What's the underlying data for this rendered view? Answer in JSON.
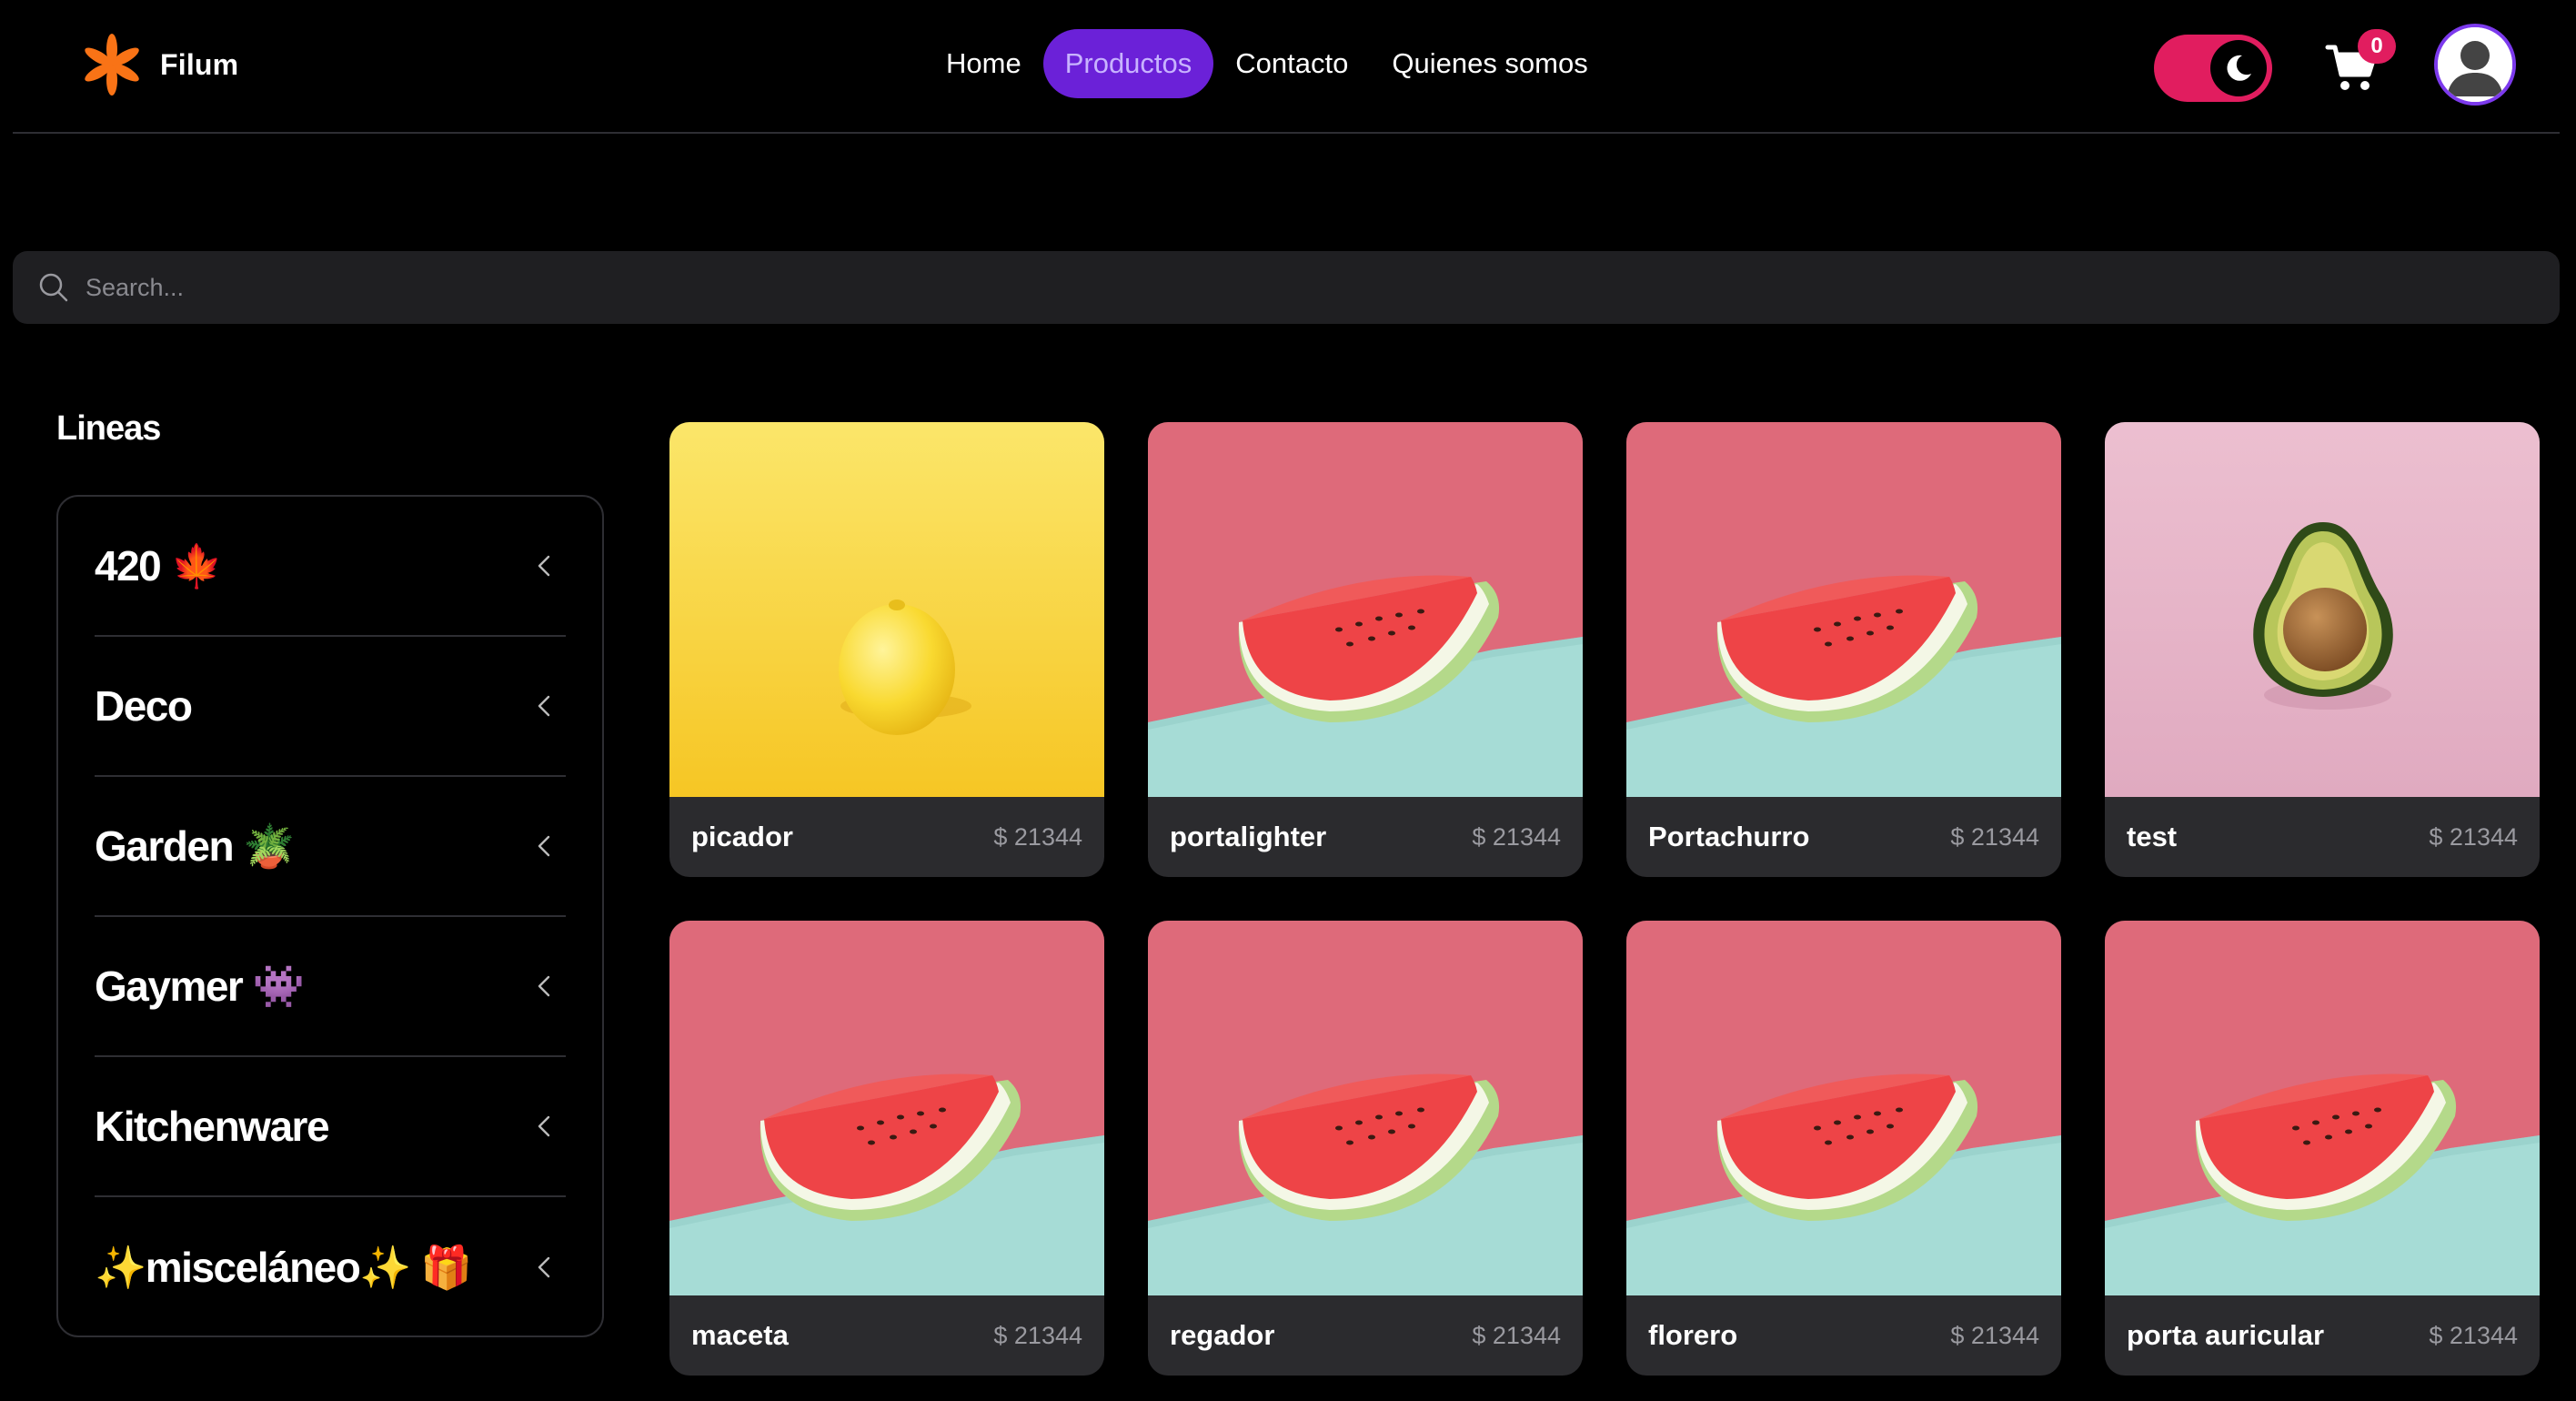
{
  "brand": {
    "name": "Filum",
    "logo_icon": "asterisk-logo-icon",
    "logo_color": "#f97316"
  },
  "nav": {
    "items": [
      {
        "label": "Home",
        "active": false
      },
      {
        "label": "Productos",
        "active": true
      },
      {
        "label": "Contacto",
        "active": false
      },
      {
        "label": "Quienes somos",
        "active": false
      }
    ]
  },
  "header": {
    "theme_toggle": {
      "icon": "moon-icon",
      "color": "#e11d5f",
      "dark_mode": true
    },
    "cart": {
      "icon": "cart-icon",
      "count": "0"
    },
    "avatar": {
      "icon": "user-avatar-icon",
      "ring_color": "#7c3aed"
    }
  },
  "search": {
    "placeholder": "Search...",
    "value": ""
  },
  "sidebar": {
    "title": "Lineas",
    "items": [
      {
        "label": "420 🍁"
      },
      {
        "label": "Deco"
      },
      {
        "label": "Garden 🪴"
      },
      {
        "label": "Gaymer 👾"
      },
      {
        "label": "Kitchenware"
      },
      {
        "label": "✨misceláneo✨ 🎁"
      }
    ]
  },
  "products": [
    {
      "name": "picador",
      "price": "$ 21344",
      "image": "lemon"
    },
    {
      "name": "portalighter",
      "price": "$ 21344",
      "image": "watermelon"
    },
    {
      "name": "Portachurro",
      "price": "$ 21344",
      "image": "watermelon"
    },
    {
      "name": "test",
      "price": "$ 21344",
      "image": "avocado"
    },
    {
      "name": "maceta",
      "price": "$ 21344",
      "image": "watermelon"
    },
    {
      "name": "regador",
      "price": "$ 21344",
      "image": "watermelon"
    },
    {
      "name": "florero",
      "price": "$ 21344",
      "image": "watermelon"
    },
    {
      "name": "porta auricular",
      "price": "$ 21344",
      "image": "watermelon"
    }
  ],
  "colors": {
    "accent": "#6b21d8",
    "active_nav_text": "#c8b3ff",
    "pink": "#e11d5f",
    "background": "#000000",
    "card_footer": "#2b2b2e"
  }
}
